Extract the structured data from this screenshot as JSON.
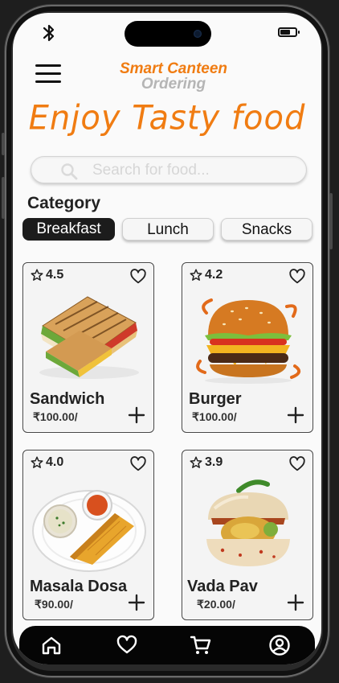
{
  "status_bar": {
    "bluetooth_icon": "bluetooth-icon",
    "battery_icon": "battery-icon",
    "battery_level": 0.6
  },
  "header": {
    "menu_icon": "hamburger-menu-icon",
    "brand_line1": "Smart Canteen",
    "brand_line2": "Ordering",
    "tagline": "Enjoy Tasty food"
  },
  "search": {
    "placeholder": "Search for food...",
    "value": "",
    "icon": "search-icon"
  },
  "category": {
    "title": "Category",
    "chips": [
      {
        "label": "Breakfast",
        "active": true
      },
      {
        "label": "Lunch",
        "active": false
      },
      {
        "label": "Snacks",
        "active": false
      }
    ]
  },
  "items": [
    {
      "name": "Sandwich",
      "rating": "4.5",
      "price": "₹100.00/"
    },
    {
      "name": "Burger",
      "rating": "4.2",
      "price": "₹100.00/"
    },
    {
      "name": "Masala Dosa",
      "rating": "4.0",
      "price": "₹90.00/"
    },
    {
      "name": "Vada Pav",
      "rating": "3.9",
      "price": "₹20.00/"
    }
  ],
  "bottom_nav": [
    "home-icon",
    "favorites-heart-icon",
    "cart-icon",
    "profile-icon"
  ],
  "colors": {
    "accent": "#f07c12",
    "brand_secondary": "#b5b5b5",
    "dark": "#1c1c1c"
  }
}
